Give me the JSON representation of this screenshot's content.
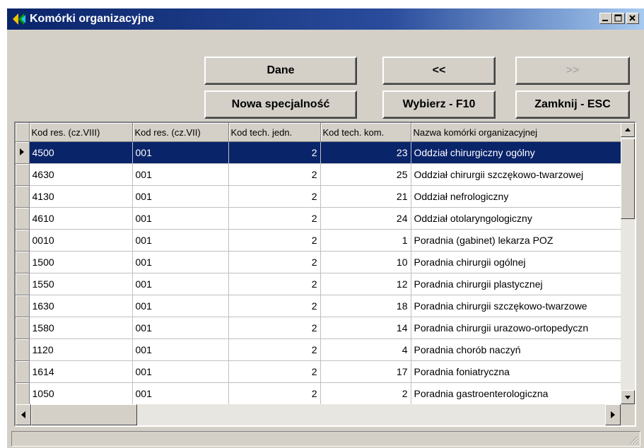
{
  "window": {
    "title": "Komórki organizacyjne",
    "icons": {
      "app": "arrows-icon",
      "minimize": "minimize-icon",
      "maximize": "maximize-icon",
      "close": "close-icon"
    }
  },
  "buttons": {
    "dane": "Dane",
    "prev": "<<",
    "next": ">>",
    "nowa_specjalnosc": "Nowa specjalność",
    "wybierz": "Wybierz - F10",
    "zamknij": "Zamknij - ESC"
  },
  "table": {
    "columns": [
      "Kod res. (cz.VIII)",
      "Kod res. (cz.VII)",
      "Kod tech. jedn.",
      "Kod tech. kom.",
      "Nazwa komórki organizacyjnej"
    ],
    "rows": [
      [
        "4500",
        "001",
        "2",
        "23",
        "Oddział chirurgiczny ogólny"
      ],
      [
        "4630",
        "001",
        "2",
        "25",
        "Oddział chirurgii szczękowo-twarzowej"
      ],
      [
        "4130",
        "001",
        "2",
        "21",
        "Oddział nefrologiczny"
      ],
      [
        "4610",
        "001",
        "2",
        "24",
        "Oddział otolaryngologiczny"
      ],
      [
        "0010",
        "001",
        "2",
        "1",
        "Poradnia (gabinet) lekarza POZ"
      ],
      [
        "1500",
        "001",
        "2",
        "10",
        "Poradnia chirurgii ogólnej"
      ],
      [
        "1550",
        "001",
        "2",
        "12",
        "Poradnia chirurgii plastycznej"
      ],
      [
        "1630",
        "001",
        "2",
        "18",
        "Poradnia chirurgii szczękowo-twarzowe"
      ],
      [
        "1580",
        "001",
        "2",
        "14",
        "Poradnia chirurgii urazowo-ortopedyczn"
      ],
      [
        "1120",
        "001",
        "2",
        "4",
        "Poradnia chorób naczyń"
      ],
      [
        "1614",
        "001",
        "2",
        "17",
        "Poradnia foniatryczna"
      ],
      [
        "1050",
        "001",
        "2",
        "2",
        "Poradnia gastroenterologiczna"
      ]
    ],
    "selected_row": 0
  },
  "colors": {
    "titlebar_start": "#0a246a",
    "titlebar_end": "#a6caf0",
    "selection": "#0a246a",
    "face": "#d4d0c8"
  }
}
